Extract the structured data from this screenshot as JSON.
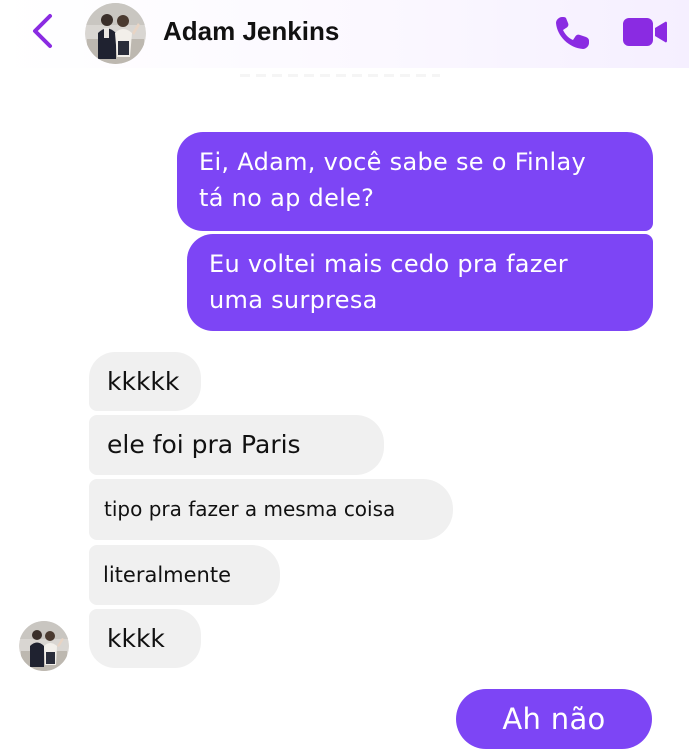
{
  "header": {
    "contact_name": "Adam Jenkins",
    "accent_color": "#8a2be2",
    "icons": [
      "chevron-left-icon",
      "avatar",
      "phone-icon",
      "video-camera-icon"
    ]
  },
  "messages": {
    "sent": [
      {
        "lines": [
          "Ei, Adam, você sabe se o Finlay",
          "tá no ap dele?"
        ]
      },
      {
        "lines": [
          "Eu voltei mais cedo pra fazer",
          "uma surpresa"
        ]
      },
      {
        "lines": [
          "Ah não"
        ]
      }
    ],
    "received": [
      {
        "text": "kkkkk"
      },
      {
        "text": "ele foi pra Paris"
      },
      {
        "text": "tipo pra fazer a mesma coisa"
      },
      {
        "text": "literalmente"
      },
      {
        "text": "kkkk"
      }
    ]
  },
  "colors": {
    "sent_bubble": "#7d45f5",
    "received_bubble": "#f0f0f0",
    "icon_purple": "#8a2be2"
  }
}
